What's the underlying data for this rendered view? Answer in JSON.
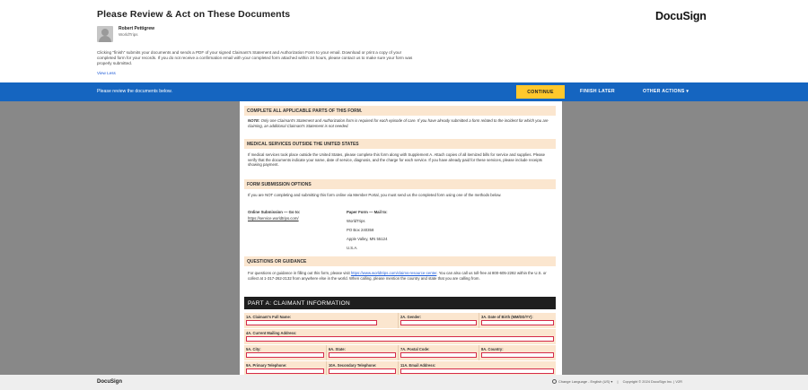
{
  "header": {
    "title": "Please Review & Act on These Documents",
    "logo": "DocuSign",
    "sender_name": "Robert Pettigrew",
    "sender_org": "WorldTrips",
    "description": "Clicking \"finish\" submits your documents and sends a PDF of your signed Claimant's Statement and Authorization Form to your email. Download or print a copy of your completed form for your records. If you do not receive a confirmation email with your completed form attached within 24 hours, please contact us to make sure your form was properly submitted.",
    "view_less": "View Less"
  },
  "actionbar": {
    "message": "Please review the documents below.",
    "continue": "CONTINUE",
    "finish_later": "FINISH LATER",
    "other_actions": "OTHER ACTIONS ▾"
  },
  "document": {
    "sec1_title": "COMPLETE ALL APPLICABLE PARTS OF THIS FORM.",
    "sec1_note_label": "NOTE:",
    "sec1_note": "Only one Claimant's Statement and Authorization form is required for each episode of care. If you have already submitted a form related to the incident for which you are claiming, an additional Claimant's Statement is not needed.",
    "sec2_title": "MEDICAL SERVICES OUTSIDE THE UNITED STATES",
    "sec2_text": "If medical services took place outside the United States, please complete this form along with Supplement A. Attach copies of all itemized bills for service and supplies. Please verify that the documents indicate your name, date of service, diagnosis, and the charge for each service. If you have already paid for these services, please include receipts showing payment.",
    "sec3_title": "FORM SUBMISSION OPTIONS",
    "sec3_text": "If you are NOT completing and submitting this form online via Member Portal, you must send us the completed form using one of the methods below.",
    "online_label": "Online Submission — Go to:",
    "online_link": "https://service.worldtrips.com/",
    "paper_label": "Paper Form — Mail to:",
    "mail_line1": "WorldTrips",
    "mail_line2": "PO Box 240358",
    "mail_line3": "Apple Valley, MN 55124",
    "mail_line4": "U.S.A.",
    "sec4_title": "QUESTIONS OR GUIDANCE",
    "sec4_text_pre": "For questions or guidance in filling out this form, please visit",
    "sec4_link": "https://www.worldtrips.com/claims-resource-center",
    "sec4_text_post": ". You can also call us toll-free at 800-605-2282 within the U.S. or collect at 1-317-262-2132 from anywhere else in the world. When calling, please mention the country and state that you are calling from.",
    "partA_title": "PART A: CLAIMANT INFORMATION",
    "fields": {
      "f1a": "1A. Claimant's Full Name:",
      "f2a": "2A. Gender:",
      "f3a": "3A. Date of Birth (MM/DD/YY):",
      "f4a": "4A. Current Mailing Address:",
      "f5a": "5A. City:",
      "f6a": "6A. State:",
      "f7a": "7A. Postal Code:",
      "f8a": "8A. Country:",
      "f9a": "9A. Primary Telephone:",
      "f10a": "10A. Secondary Telephone:",
      "f11a": "11A. Email Address:"
    }
  },
  "footer": {
    "logo": "DocuSign",
    "language": "Change Language - English (US) ▾",
    "copyright": "Copyright © 2024 DocuSign Inc. | V2R"
  },
  "colors": {
    "action_bar": "#1565c0",
    "continue_button": "#ffc82c",
    "section_header": "#fbe6cf",
    "field_border": "#d42a4a"
  }
}
